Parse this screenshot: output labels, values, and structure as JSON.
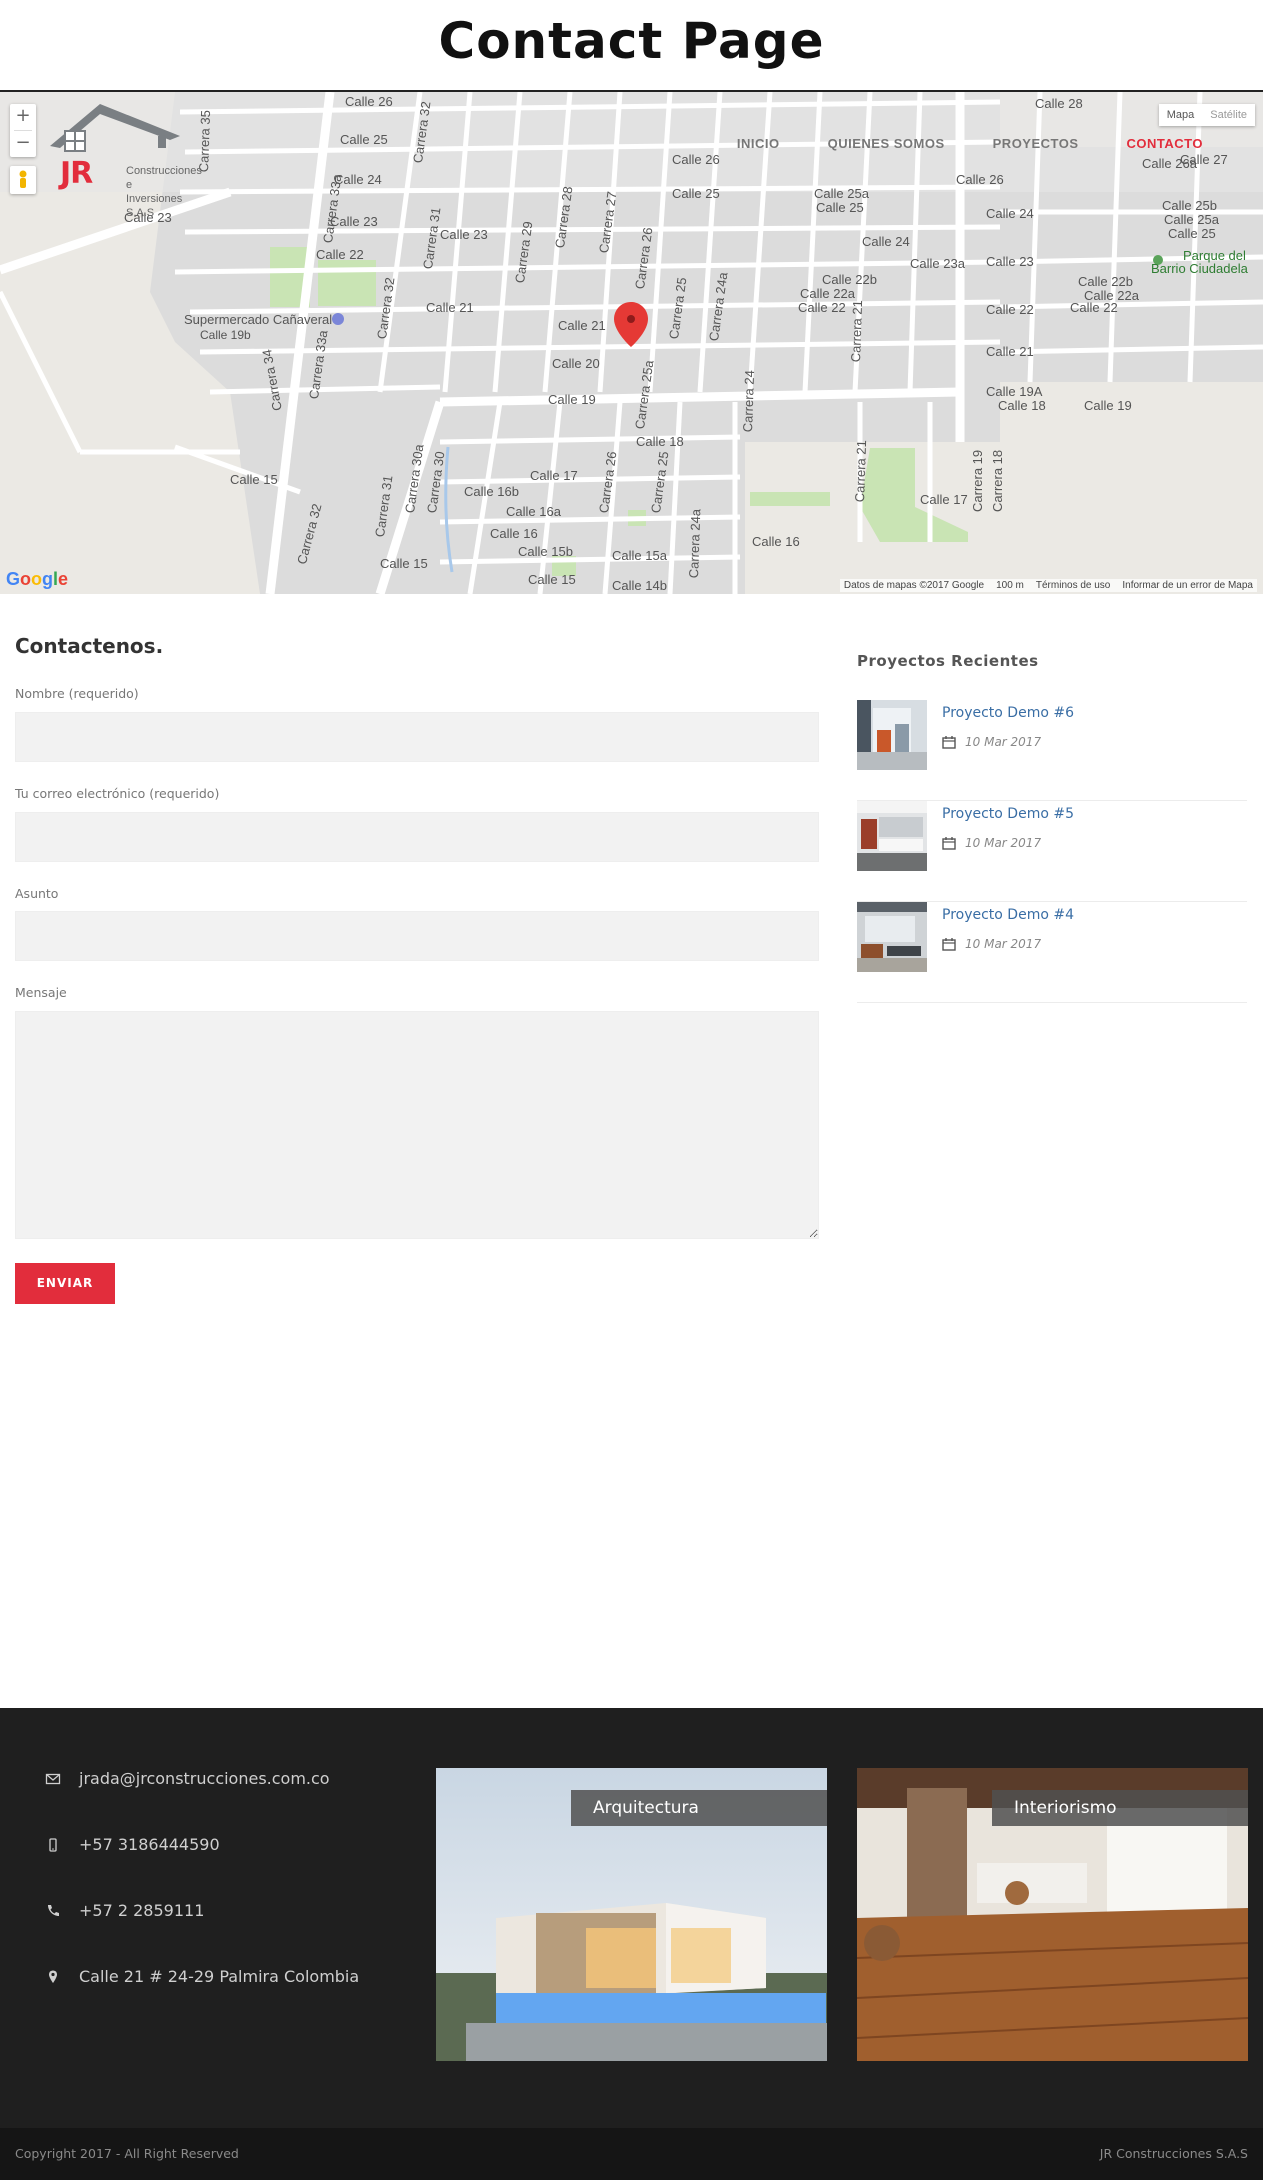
{
  "page": {
    "title": "Contact Page"
  },
  "header": {
    "logo": {
      "mark": "JR",
      "tagline_line1": "Construcciones e",
      "tagline_line2": "Inversiones S.A.S"
    },
    "nav": [
      {
        "label": "INICIO",
        "active": false
      },
      {
        "label": "QUIENES SOMOS",
        "active": false
      },
      {
        "label": "PROYECTOS",
        "active": false
      },
      {
        "label": "CONTACTO",
        "active": true
      }
    ]
  },
  "map": {
    "zoom_in": "+",
    "zoom_out": "−",
    "type_map": "Mapa",
    "type_satellite": "Satélite",
    "google": "Google",
    "footer_data": "Datos de mapas ©2017 Google",
    "footer_scale": "100 m",
    "footer_terms": "Términos de uso",
    "footer_report": "Informar de un error de Mapa",
    "labels": {
      "supermarket": "Supermercado Cañaveral",
      "park_line1": "Parque del",
      "park_line2": "Barrio Ciudadela",
      "calle18": "Calle 18",
      "calle19": "Calle 19",
      "calle20": "Calle 20",
      "calle21": "Calle 21",
      "calle22": "Calle 22",
      "calle23": "Calle 23",
      "calle24": "Calle 24",
      "calle25": "Calle 25",
      "calle26": "Calle 26",
      "calle27": "Calle 27",
      "calle28": "Calle 28",
      "calle17": "Calle 17",
      "calle16": "Calle 16",
      "calle16a": "Calle 16a",
      "calle16b": "Calle 16b",
      "calle15": "Calle 15",
      "calle15a": "Calle 15a",
      "calle15b": "Calle 15b",
      "calle14b": "Calle 14b",
      "calle19a": "Calle 19A",
      "calle19b": "Calle 19b",
      "calle22a": "Calle 22a",
      "calle22b": "Calle 22b",
      "calle23a": "Calle 23a",
      "calle25a": "Calle 25a",
      "calle25b": "Calle 25b",
      "calle26a": "Calle 26a",
      "carrera18": "Carrera 18",
      "carrera19": "Carrera 19",
      "carrera21": "Carrera 21",
      "carrera24": "Carrera 24",
      "carrera24a": "Carrera 24a",
      "carrera25": "Carrera 25",
      "carrera25a": "Carrera 25a",
      "carrera26": "Carrera 26",
      "carrera27": "Carrera 27",
      "carrera28": "Carrera 28",
      "carrera29": "Carrera 29",
      "carrera30": "Carrera 30",
      "carrera30a": "Carrera 30a",
      "carrera31": "Carrera 31",
      "carrera32": "Carrera 32",
      "carrera33a": "Carrera 33a",
      "carrera34": "Carrera 34",
      "carrera35": "Carrera 35"
    }
  },
  "form": {
    "heading": "Contactenos.",
    "name_label": "Nombre (requerido)",
    "name_value": "",
    "email_label": "Tu correo electrónico (requerido)",
    "email_value": "",
    "subject_label": "Asunto",
    "subject_value": "",
    "message_label": "Mensaje",
    "message_value": "",
    "submit_label": "ENVIAR"
  },
  "sidebar": {
    "title": "Proyectos Recientes",
    "items": [
      {
        "title": "Proyecto Demo #6",
        "date": "10 Mar 2017"
      },
      {
        "title": "Proyecto Demo #5",
        "date": "10 Mar 2017"
      },
      {
        "title": "Proyecto Demo #4",
        "date": "10 Mar 2017"
      }
    ]
  },
  "footer": {
    "contacts": [
      {
        "icon": "envelope-icon",
        "text": "jrada@jrconstrucciones.com.co"
      },
      {
        "icon": "mobile-icon",
        "text": "+57 3186444590"
      },
      {
        "icon": "phone-icon",
        "text": "+57 2 2859111"
      },
      {
        "icon": "map-marker-icon",
        "text": "Calle 21 # 24-29 Palmira Colombia"
      }
    ],
    "promos": [
      {
        "label": "Arquitectura"
      },
      {
        "label": "Interiorismo"
      }
    ],
    "copyright": "Copyright 2017 - All Right Reserved",
    "company": "JR Construcciones S.A.S"
  },
  "colors": {
    "accent": "#e22d3c",
    "link": "#3a6ea5",
    "footer_bg": "#1f1f1f",
    "bottom_bar_bg": "#151515",
    "input_bg": "#f2f2f2"
  }
}
